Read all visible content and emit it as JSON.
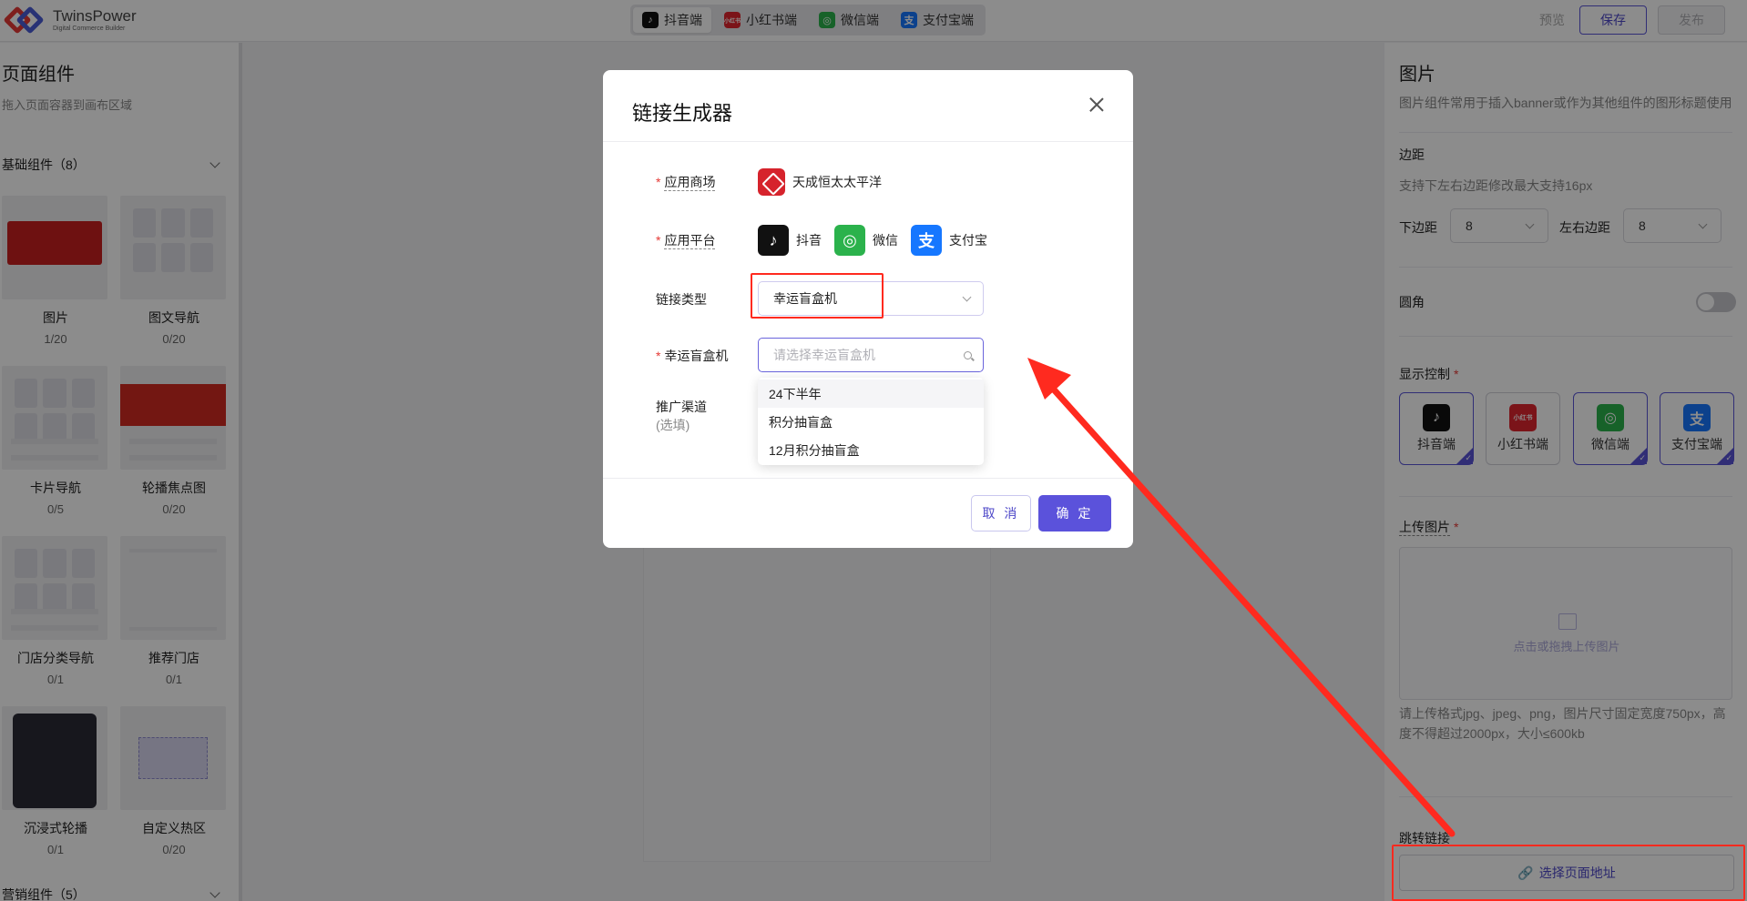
{
  "app": {
    "name": "TwinsPower",
    "tagline": "Digital Commerce Builder"
  },
  "topbar": {
    "platform_tabs": [
      {
        "label": "抖音端",
        "icon": "douyin-icon",
        "active": true
      },
      {
        "label": "小红书端",
        "icon": "xiaohongshu-icon",
        "active": false
      },
      {
        "label": "微信端",
        "icon": "wechat-icon",
        "active": false
      },
      {
        "label": "支付宝端",
        "icon": "alipay-icon",
        "active": false
      }
    ],
    "preview_label": "预览",
    "save_label": "保存",
    "publish_label": "发布"
  },
  "left_panel": {
    "title": "页面组件",
    "description": "拖入页面容器到画布区域",
    "sections": [
      {
        "label": "基础组件（8）"
      },
      {
        "label": "营销组件（5）"
      }
    ],
    "components": [
      {
        "name": "图片",
        "count": "1/20"
      },
      {
        "name": "图文导航",
        "count": "0/20"
      },
      {
        "name": "卡片导航",
        "count": "0/5"
      },
      {
        "name": "轮播焦点图",
        "count": "0/20"
      },
      {
        "name": "门店分类导航",
        "count": "0/1"
      },
      {
        "name": "推荐门店",
        "count": "0/1"
      },
      {
        "name": "沉浸式轮播",
        "count": "0/1"
      },
      {
        "name": "自定义热区",
        "count": "0/20"
      }
    ]
  },
  "right_panel": {
    "title": "图片",
    "description": "图片组件常用于插入banner或作为其他组件的图形标题使用",
    "margin": {
      "label": "边距",
      "hint": "支持下左右边距修改最大支持16px",
      "bottom_label": "下边距",
      "bottom_value": "8",
      "side_label": "左右边距",
      "side_value": "8"
    },
    "rounded": {
      "label": "圆角",
      "enabled": false
    },
    "display_control": {
      "label": "显示控制",
      "items": [
        {
          "label": "抖音端",
          "icon": "douyin-icon",
          "selected": true,
          "icon_text": "♪"
        },
        {
          "label": "小红书端",
          "icon": "xiaohongshu-icon",
          "selected": false,
          "icon_text": "小红书"
        },
        {
          "label": "微信端",
          "icon": "wechat-icon",
          "selected": true,
          "icon_text": "◎"
        },
        {
          "label": "支付宝端",
          "icon": "alipay-icon",
          "selected": true,
          "icon_text": "支"
        }
      ]
    },
    "upload": {
      "label": "上传图片",
      "placeholder": "点击或拖拽上传图片",
      "note": "请上传格式jpg、jpeg、png，图片尺寸固定宽度750px，高度不得超过2000px，大小≤600kb"
    },
    "jump_link": {
      "label": "跳转链接",
      "button_label": "选择页面地址"
    }
  },
  "modal": {
    "title": "链接生成器",
    "fields": {
      "mall_label": "应用商场",
      "mall_value": "天成恒太太平洋",
      "platform_label": "应用平台",
      "platforms": [
        {
          "label": "抖音",
          "icon": "douyin-icon",
          "icon_text": "♪"
        },
        {
          "label": "微信",
          "icon": "wechat-icon",
          "icon_text": "◎"
        },
        {
          "label": "支付宝",
          "icon": "alipay-icon",
          "icon_text": "支"
        }
      ],
      "link_type_label": "链接类型",
      "link_type_value": "幸运盲盒机",
      "blindbox_label": "幸运盲盒机",
      "blindbox_placeholder": "请选择幸运盲盒机",
      "channel_label": "推广渠道",
      "channel_sub": "(选填)"
    },
    "dropdown_options": [
      "24下半年",
      "积分抽盲盒",
      "12月积分抽盲盒"
    ],
    "cancel_label": "取 消",
    "ok_label": "确 定"
  },
  "colors": {
    "accent": "#5b52db",
    "annotation": "#ff2a1f",
    "required": "#e53935"
  }
}
